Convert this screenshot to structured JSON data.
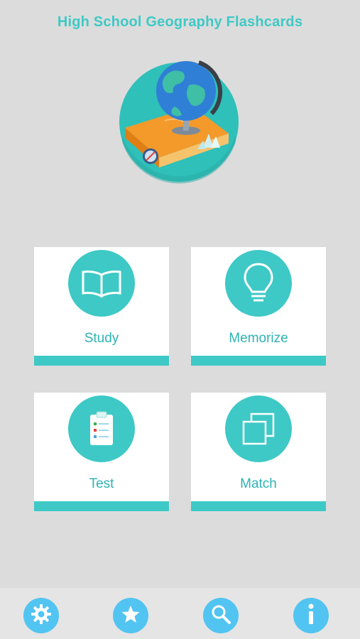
{
  "header": {
    "title": "High School Geography Flashcards"
  },
  "logo": {
    "icon": "globe-book-icon"
  },
  "menu": {
    "study": {
      "label": "Study",
      "icon": "open-book-icon"
    },
    "memorize": {
      "label": "Memorize",
      "icon": "lightbulb-icon"
    },
    "test": {
      "label": "Test",
      "icon": "clipboard-checklist-icon"
    },
    "match": {
      "label": "Match",
      "icon": "overlapping-squares-icon"
    }
  },
  "bottom_nav": [
    {
      "icon": "gear-icon"
    },
    {
      "icon": "star-icon"
    },
    {
      "icon": "search-icon"
    },
    {
      "icon": "info-icon"
    }
  ],
  "colors": {
    "accent": "#3ec9c6",
    "nav_button": "#52c4f1",
    "background": "#dcdcdc"
  }
}
